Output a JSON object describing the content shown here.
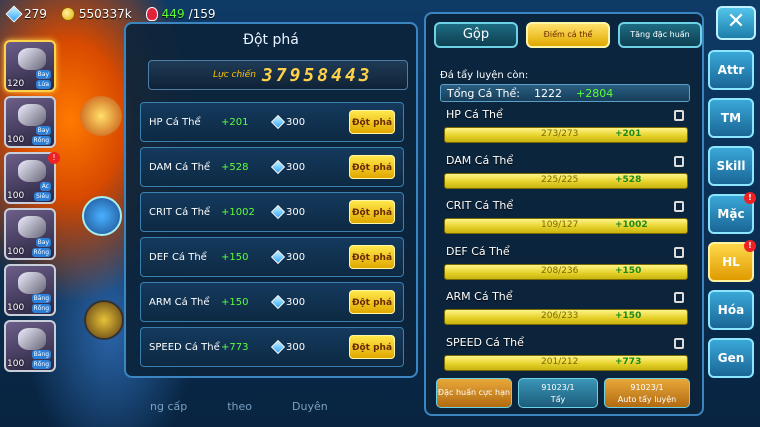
{
  "topbar": {
    "gems": "279",
    "coins": "550337k",
    "potions_current": "449",
    "potions_max": "/159"
  },
  "roster": [
    {
      "level": "120",
      "tags": [
        "Bay",
        "Lửa"
      ]
    },
    {
      "level": "100",
      "tags": [
        "Bay",
        "Rồng"
      ]
    },
    {
      "level": "100",
      "tags": [
        "Ác",
        "Siêu"
      ]
    },
    {
      "level": "100",
      "tags": [
        "Bay",
        "Rồng"
      ]
    },
    {
      "level": "100",
      "tags": [
        "Băng",
        "Rồng"
      ]
    },
    {
      "level": "100",
      "tags": [
        "Băng",
        "Rồng"
      ]
    }
  ],
  "left_panel": {
    "title": "Đột phá",
    "power_label": "Lực chiến",
    "power_value": "37958443",
    "rows": [
      {
        "name": "HP Cá Thể",
        "plus": "+201",
        "cost": "300",
        "button": "Đột phá"
      },
      {
        "name": "DAM Cá Thể",
        "plus": "+528",
        "cost": "300",
        "button": "Đột phá"
      },
      {
        "name": "CRIT Cá Thể",
        "plus": "+1002",
        "cost": "300",
        "button": "Đột phá"
      },
      {
        "name": "DEF Cá Thể",
        "plus": "+150",
        "cost": "300",
        "button": "Đột phá"
      },
      {
        "name": "ARM Cá Thể",
        "plus": "+150",
        "cost": "300",
        "button": "Đột phá"
      },
      {
        "name": "SPEED Cá Thể",
        "plus": "+773",
        "cost": "300",
        "button": "Đột phá"
      }
    ]
  },
  "right_panel": {
    "tabs": [
      "Gộp",
      "Điểm cá thể",
      "Tăng đặc huấn"
    ],
    "remaining_label": "Đá tẩy luyện còn:",
    "total_label": "Tổng Cá Thể:",
    "total_value": "1222",
    "total_plus": "+2804",
    "stats": [
      {
        "name": "HP Cá Thể",
        "current": "273/273",
        "plus": "+201"
      },
      {
        "name": "DAM Cá Thể",
        "current": "225/225",
        "plus": "+528"
      },
      {
        "name": "CRIT Cá Thể",
        "current": "109/127",
        "plus": "+1002"
      },
      {
        "name": "DEF Cá Thể",
        "current": "208/236",
        "plus": "+150"
      },
      {
        "name": "ARM Cá Thể",
        "current": "206/233",
        "plus": "+150"
      },
      {
        "name": "SPEED Cá Thể",
        "current": "201/212",
        "plus": "+773"
      }
    ],
    "buttons": {
      "special": "Đặc huấn cực hạn",
      "wash_count": "91023/1",
      "wash": "Tẩy",
      "auto_count": "91023/1",
      "auto": "Auto tẩy luyện"
    }
  },
  "side": [
    "Attr",
    "TM",
    "Skill",
    "Mặc",
    "HL",
    "Hóa",
    "Gen"
  ],
  "underneath": [
    "ng cấp",
    "theo",
    "Duyên"
  ]
}
